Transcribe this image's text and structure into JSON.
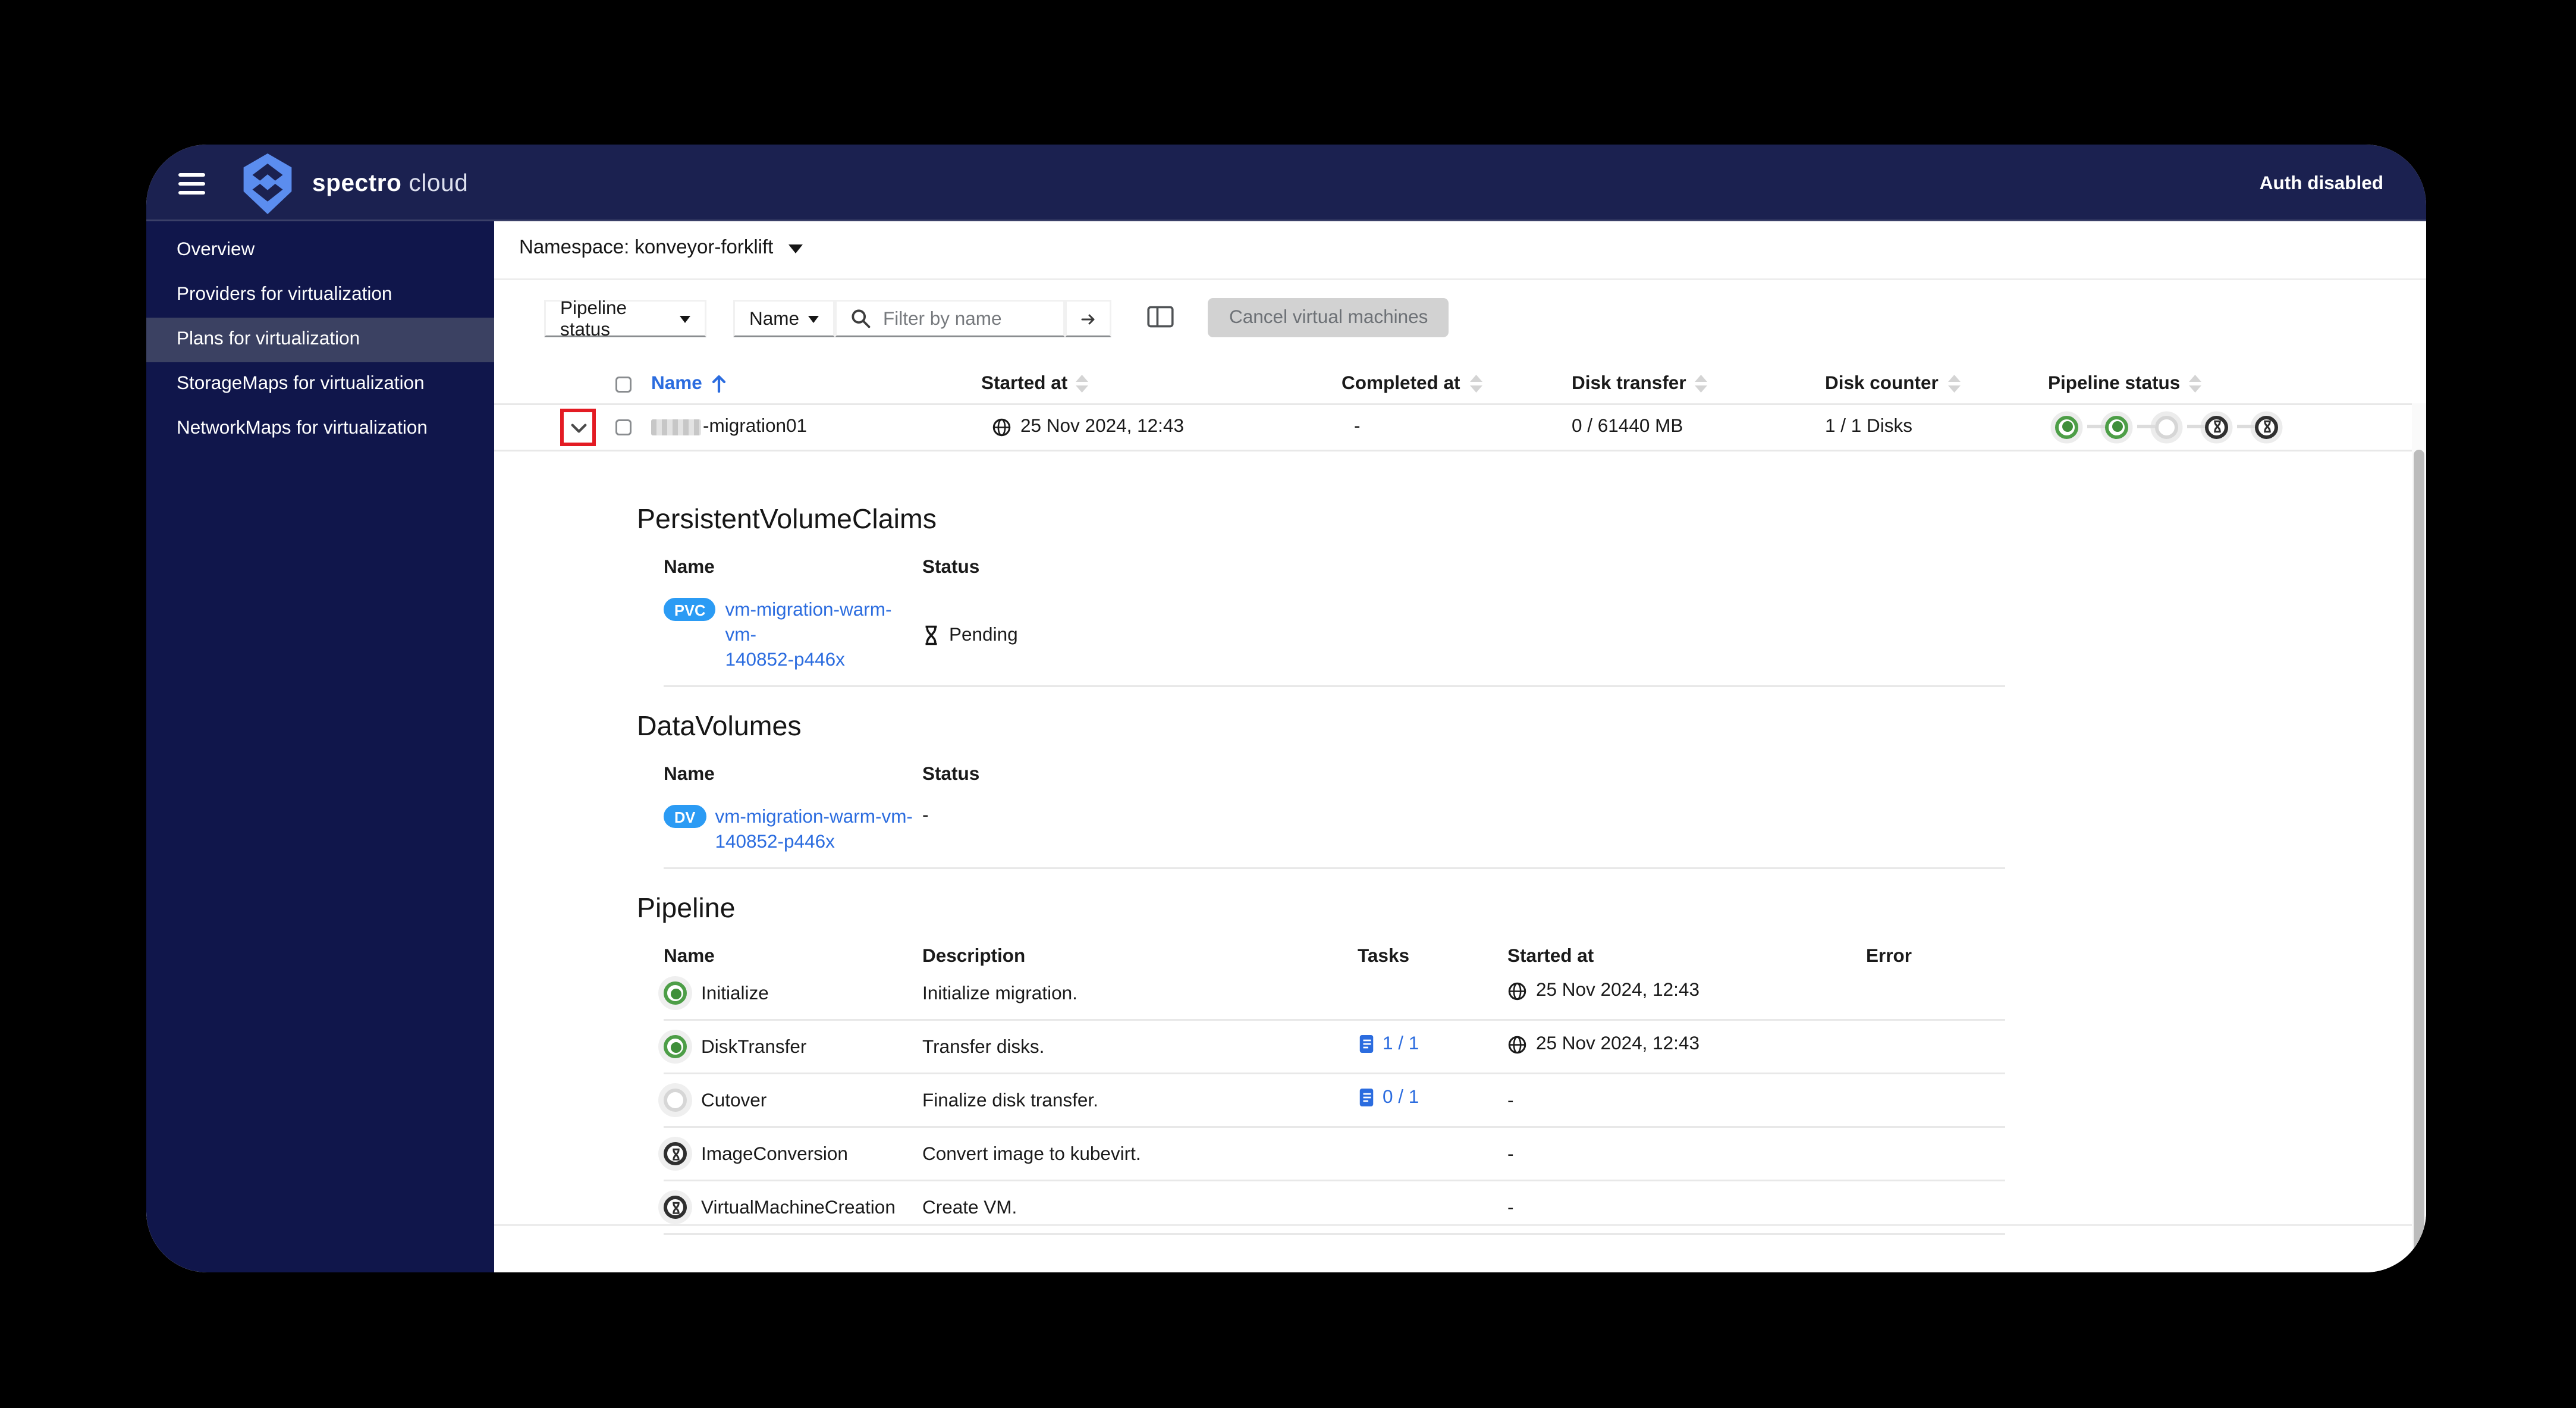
{
  "colors": {
    "header_navy": "#1b2150",
    "sidebar_navy": "#10164b",
    "sidebar_active": "#3b4162",
    "accent_blue": "#2b6cdf",
    "badge_blue": "#2b9bf4",
    "success_green": "#4d9e47",
    "annotation_red": "#e31b23",
    "disabled_gray": "#d2d2d2"
  },
  "icons": {
    "hamburger": "menu",
    "brand_logo": "spectro-cloud-shield",
    "dropdown_caret": "▾",
    "search": "magnifier",
    "submit": "arrow-right",
    "manage_columns": "columns",
    "expand_row": "chevron-down",
    "sort": "up-down-arrows",
    "sorted_asc": "up-arrow",
    "date": "globe",
    "pending": "hourglass",
    "tasks": "list-clipboard"
  },
  "header": {
    "brand_primary": "spectro",
    "brand_secondary": "cloud",
    "auth_status": "Auth disabled"
  },
  "sidebar": {
    "items": [
      {
        "label": "Overview",
        "active": false
      },
      {
        "label": "Providers for virtualization",
        "active": false
      },
      {
        "label": "Plans for virtualization",
        "active": true
      },
      {
        "label": "StorageMaps for virtualization",
        "active": false
      },
      {
        "label": "NetworkMaps for virtualization",
        "active": false
      }
    ]
  },
  "content": {
    "namespace_selector": "Namespace: konveyor-forklift",
    "toolbar": {
      "pipeline_status_dropdown": "Pipeline status",
      "name_dropdown": "Name",
      "search_placeholder": "Filter by name",
      "cancel_button": "Cancel virtual machines"
    },
    "table": {
      "headers": {
        "name": "Name",
        "started_at": "Started at",
        "completed_at": "Completed at",
        "disk_transfer": "Disk transfer",
        "disk_counter": "Disk counter",
        "pipeline_status": "Pipeline status"
      },
      "row": {
        "name_suffix": "-migration01",
        "started_at": "25 Nov 2024, 12:43",
        "completed_at": "-",
        "disk_transfer": "0 / 61440 MB",
        "disk_counter": "1 / 1 Disks",
        "steps": [
          {
            "state": "done"
          },
          {
            "state": "done"
          },
          {
            "state": "empty"
          },
          {
            "state": "pending"
          },
          {
            "state": "pending"
          }
        ]
      }
    },
    "pvc": {
      "title": "PersistentVolumeClaims",
      "name_header": "Name",
      "status_header": "Status",
      "badge": "PVC",
      "name_line1": "vm-migration-warm-vm-",
      "name_line2": "140852-p446x",
      "status": "Pending"
    },
    "dv": {
      "title": "DataVolumes",
      "name_header": "Name",
      "status_header": "Status",
      "badge": "DV",
      "name_line1": "vm-migration-warm-vm-",
      "name_line2": "140852-p446x",
      "status": "-"
    },
    "pipeline": {
      "title": "Pipeline",
      "headers": {
        "name": "Name",
        "description": "Description",
        "tasks": "Tasks",
        "started_at": "Started at",
        "error": "Error"
      },
      "rows": [
        {
          "state": "done",
          "name": "Initialize",
          "description": "Initialize migration.",
          "tasks": "",
          "started_at": "25 Nov 2024, 12:43",
          "started_icon": true,
          "error": ""
        },
        {
          "state": "done",
          "name": "DiskTransfer",
          "description": "Transfer disks.",
          "tasks": "1 / 1",
          "started_at": "25 Nov 2024, 12:43",
          "started_icon": true,
          "error": ""
        },
        {
          "state": "empty",
          "name": "Cutover",
          "description": "Finalize disk transfer.",
          "tasks": "0 / 1",
          "started_at": "-",
          "started_icon": false,
          "error": ""
        },
        {
          "state": "pending",
          "name": "ImageConversion",
          "description": "Convert image to kubevirt.",
          "tasks": "",
          "started_at": "-",
          "started_icon": false,
          "error": ""
        },
        {
          "state": "pending",
          "name": "VirtualMachineCreation",
          "description": "Create VM.",
          "tasks": "",
          "started_at": "-",
          "started_icon": false,
          "error": ""
        }
      ]
    }
  }
}
